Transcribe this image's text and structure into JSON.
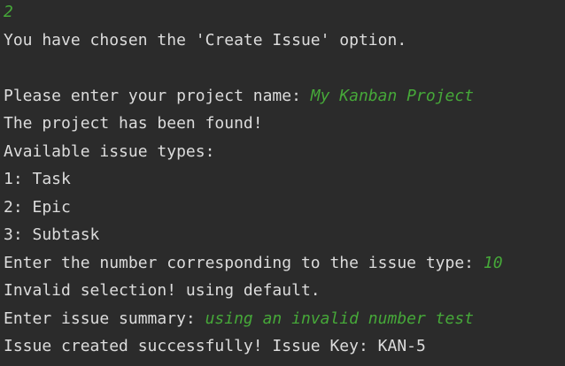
{
  "console": {
    "lines": [
      {
        "output": "",
        "input": "2"
      },
      {
        "output": "You have chosen the 'Create Issue' option.",
        "input": ""
      },
      {
        "output": "",
        "input": ""
      },
      {
        "output": "Please enter your project name: ",
        "input": "My Kanban Project"
      },
      {
        "output": "The project has been found!",
        "input": ""
      },
      {
        "output": "Available issue types:",
        "input": ""
      },
      {
        "output": "1: Task",
        "input": ""
      },
      {
        "output": "2: Epic",
        "input": ""
      },
      {
        "output": "3: Subtask",
        "input": ""
      },
      {
        "output": "Enter the number corresponding to the issue type: ",
        "input": "10"
      },
      {
        "output": "Invalid selection! using default.",
        "input": ""
      },
      {
        "output": "Enter issue summary: ",
        "input": "using an invalid number test"
      },
      {
        "output": "Issue created successfully! Issue Key: KAN-5",
        "input": ""
      }
    ]
  },
  "colors": {
    "background": "#2b2b2b",
    "output_text": "#dcdcdc",
    "user_input": "#46a839"
  }
}
